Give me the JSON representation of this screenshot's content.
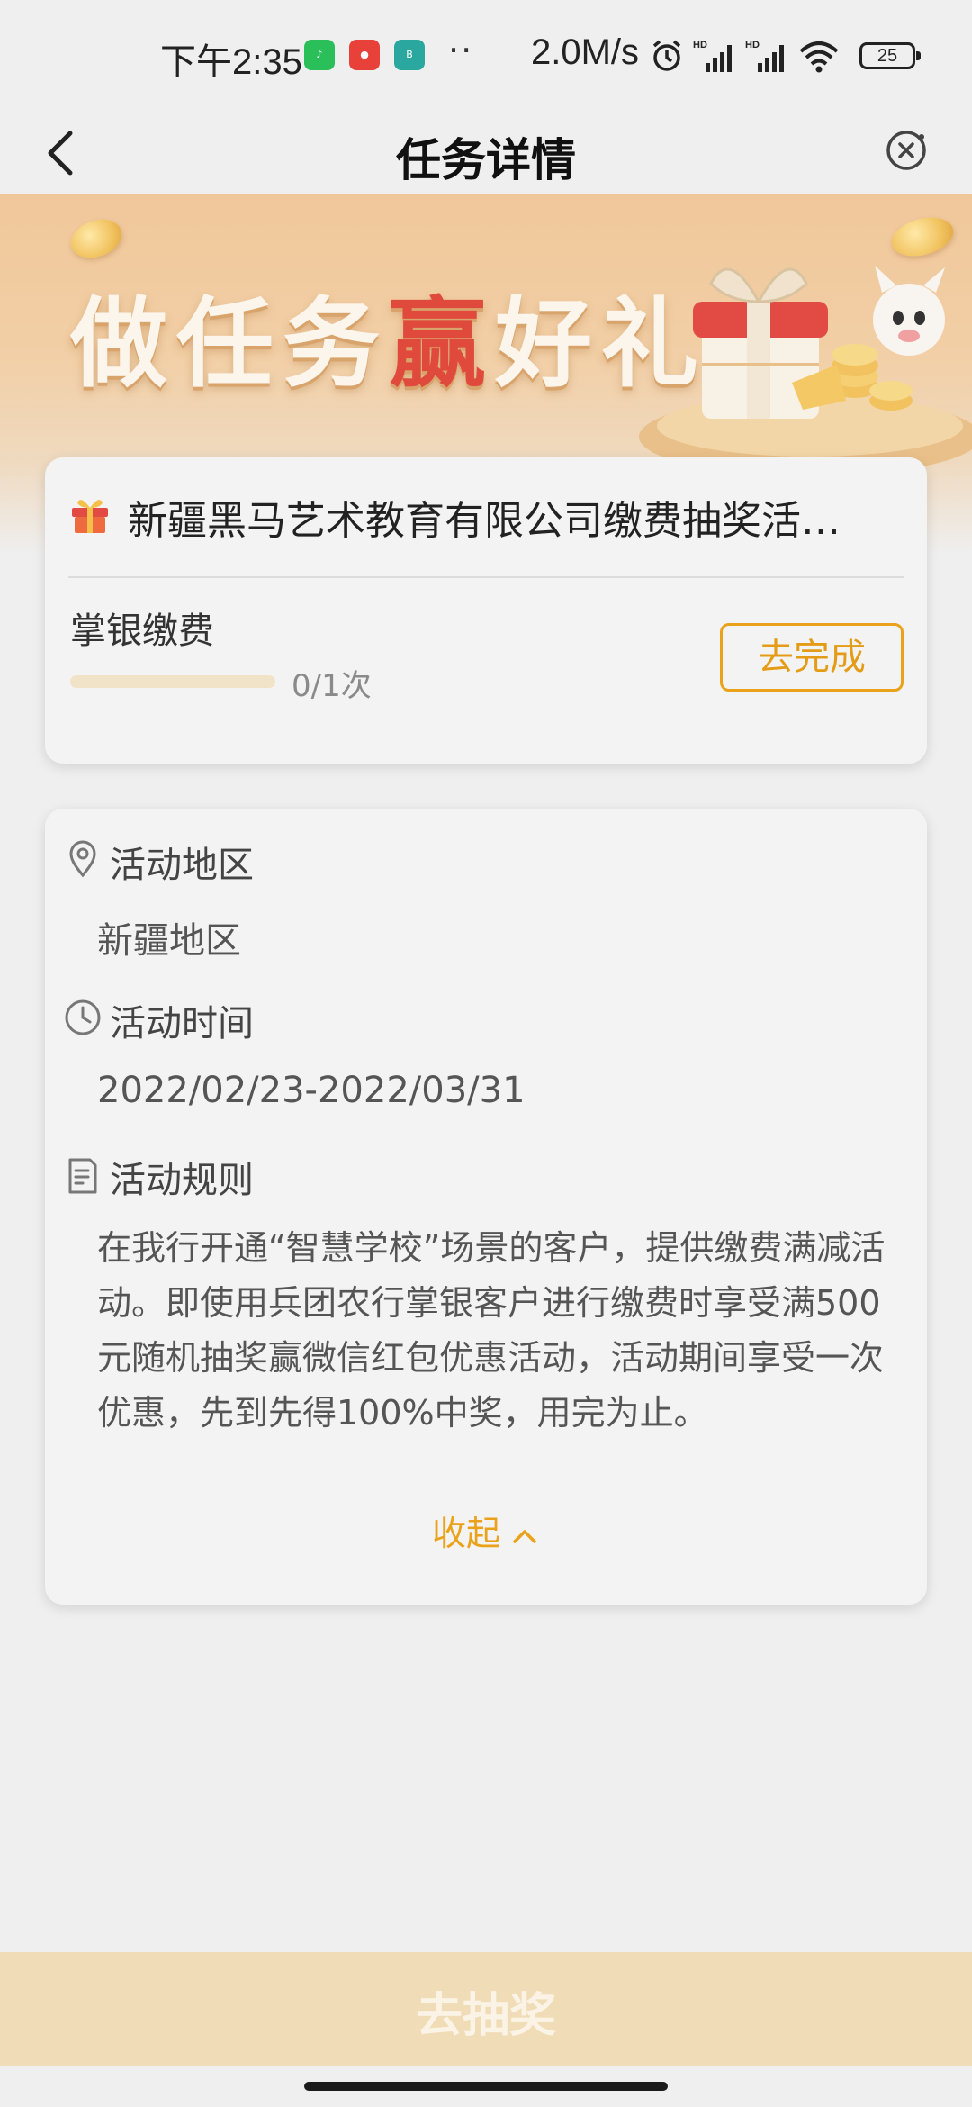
{
  "status_bar": {
    "time": "下午2:35",
    "app_icons": [
      "语音多多",
      "app-red",
      "BOSS直聘"
    ],
    "more": "··",
    "network_speed": "2.0M/s",
    "battery": "25"
  },
  "header": {
    "title": "任务详情"
  },
  "banner": {
    "slogan_part1": "做任务",
    "slogan_win": "赢",
    "slogan_part2": "好礼"
  },
  "task_card": {
    "title": "新疆黑马艺术教育有限公司缴费抽奖活…",
    "task_name": "掌银缴费",
    "progress": 0,
    "progress_text": "0/1次",
    "go_button": "去完成"
  },
  "details": {
    "region_label": "活动地区",
    "region_value": "新疆地区",
    "time_label": "活动时间",
    "time_value": "2022/02/23-2022/03/31",
    "rules_label": "活动规则",
    "rules_text": "在我行开通“智慧学校”场景的客户，提供缴费满减活动。即使用兵团农行掌银客户进行缴费时享受满500元随机抽奖赢微信红包优惠活动，活动期间享受一次优惠，先到先得100%中奖，用完为止。",
    "collapse_label": "收起"
  },
  "bottom": {
    "draw_button": "去抽奖"
  },
  "colors": {
    "accent": "#e9a21a",
    "banner": "#f0c79a",
    "win_red": "#e04a3c",
    "bottom_bar": "#f0ddb8"
  }
}
